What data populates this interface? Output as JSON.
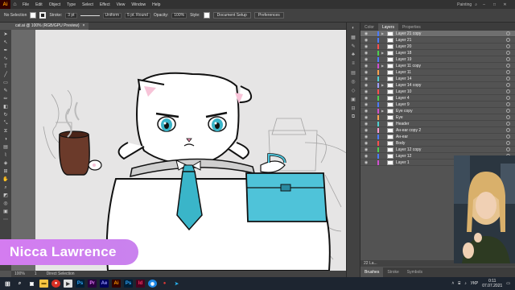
{
  "app": {
    "logo": "Ai"
  },
  "menu": [
    "File",
    "Edit",
    "Object",
    "Type",
    "Select",
    "Effect",
    "View",
    "Window",
    "Help"
  ],
  "workspace": {
    "label": "Painting"
  },
  "control": {
    "selection": "No Selection",
    "stroke_label": "Stroke:",
    "stroke_width": "3 pt",
    "profile": "Uniform",
    "brush": "5 pt. Round",
    "opacity_label": "Opacity:",
    "opacity": "100%",
    "style_label": "Style:",
    "doc_setup": "Document Setup",
    "preferences": "Preferences"
  },
  "document": {
    "tab_title": "cat.ai @ 100% (RGB/GPU Preview)",
    "close": "×"
  },
  "status": {
    "zoom": "100%",
    "artboard": "1",
    "mode": "Direct Selection"
  },
  "layers_panel": {
    "tabs": [
      "Color",
      "Layers",
      "Properties"
    ],
    "active_tab": "Layers",
    "layers": [
      {
        "name": "Layer 21 copy",
        "color": "#4b7bff",
        "selected": true,
        "expand": true
      },
      {
        "name": "Layer 21",
        "color": "#4b7bff",
        "expand": false
      },
      {
        "name": "Layer 20",
        "color": "#ff4f4f",
        "expand": false
      },
      {
        "name": "Layer 18",
        "color": "#4fd14f",
        "expand": true
      },
      {
        "name": "Layer 19",
        "color": "#4b7bff",
        "expand": false
      },
      {
        "name": "Layer 11 copy",
        "color": "#d14fd1",
        "expand": true
      },
      {
        "name": "Layer 11",
        "color": "#ffa24f",
        "expand": false
      },
      {
        "name": "Layer 14",
        "color": "#4fd1d1",
        "expand": false
      },
      {
        "name": "Layer 14 copy",
        "color": "#a0a0ff",
        "expand": true
      },
      {
        "name": "Layer 10",
        "color": "#ff4f4f",
        "expand": false
      },
      {
        "name": "Layer 4",
        "color": "#4fd14f",
        "expand": false
      },
      {
        "name": "Layer 9",
        "color": "#4b7bff",
        "expand": false
      },
      {
        "name": "Eye copy",
        "color": "#d14fd1",
        "expand": true
      },
      {
        "name": "Eye",
        "color": "#ffa24f",
        "expand": false
      },
      {
        "name": "Header",
        "color": "#4fd1d1",
        "expand": false
      },
      {
        "name": "Aн-ear copy 2",
        "color": "#ff9ad1",
        "expand": false
      },
      {
        "name": "Aн-ear",
        "color": "#4b7bff",
        "expand": false
      },
      {
        "name": "Body",
        "color": "#ff4f4f",
        "expand": false
      },
      {
        "name": "Layer 12 copy",
        "color": "#4fd14f",
        "expand": false
      },
      {
        "name": "Layer 12",
        "color": "#4b7bff",
        "expand": false
      },
      {
        "name": "Layer 1",
        "color": "#d14fd1",
        "expand": false
      }
    ],
    "count_label": "22 La...",
    "bottom_tabs": [
      "Brushes",
      "Stroke",
      "Symbols"
    ],
    "active_bottom_tab": "Brushes"
  },
  "overlay": {
    "name": "Nicca Lawrence"
  },
  "taskbar": {
    "apps": [
      {
        "label": "Ps",
        "bg": "#001e36",
        "fg": "#31a8ff"
      },
      {
        "label": "Pr",
        "bg": "#2a003f",
        "fg": "#e77cff"
      },
      {
        "label": "Ae",
        "bg": "#00005b",
        "fg": "#9999ff"
      },
      {
        "label": "Ai",
        "bg": "#330000",
        "fg": "#ff9a00"
      },
      {
        "label": "Ps",
        "bg": "#001e36",
        "fg": "#31a8ff"
      },
      {
        "label": "Id",
        "bg": "#49021f",
        "fg": "#ff3366"
      }
    ],
    "lang": "УКР",
    "time": "0:11",
    "date": "07.07.2021"
  }
}
